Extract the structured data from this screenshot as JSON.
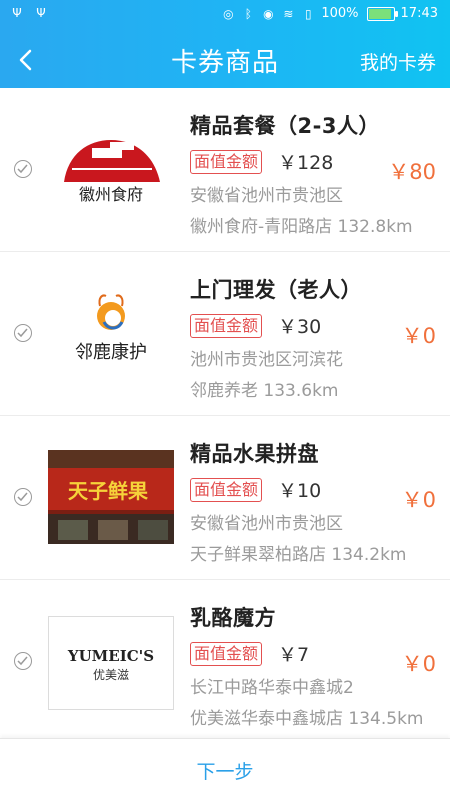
{
  "status_bar": {
    "icons_left": [
      "usb-icon",
      "usb-icon"
    ],
    "icons_right": [
      "vibrate-icon",
      "bluetooth-icon",
      "eye-icon",
      "wifi-icon",
      "sim-icon"
    ],
    "battery": "100%",
    "battery_level": 1.0,
    "time": "17:43"
  },
  "header": {
    "title": "卡券商品",
    "my_cards": "我的卡券"
  },
  "colors": {
    "header_gradient": [
      "#2aa8f0",
      "#10c3f2"
    ],
    "price": "#f0703c",
    "face_tag": "#e35050",
    "next_button": "#2aa0e8"
  },
  "items": [
    {
      "name": "精品套餐（2-3人）",
      "face_label": "面值金额",
      "face_value": "￥128",
      "address": "安徽省池州市贵池区",
      "store": "徽州食府-青阳路店 132.8km",
      "price": "￥80",
      "logo_text": "徽州食府"
    },
    {
      "name": "上门理发（老人）",
      "face_label": "面值金额",
      "face_value": "￥30",
      "address": "池州市贵池区河滨花",
      "store": "邻鹿养老 133.6km",
      "price": "￥0",
      "logo_text": "邻鹿康护"
    },
    {
      "name": "精品水果拼盘",
      "face_label": "面值金额",
      "face_value": "￥10",
      "address": "安徽省池州市贵池区",
      "store": "天子鲜果翠柏路店 134.2km",
      "price": "￥0",
      "logo_text": "天子鲜果"
    },
    {
      "name": "乳酪魔方",
      "face_label": "面值金额",
      "face_value": "￥7",
      "address": "长江中路华泰中鑫城2",
      "store": "优美滋华泰中鑫城店 134.5km",
      "price": "￥0",
      "logo_text": "YUMEIC'S",
      "logo_subtext": "优美滋"
    }
  ],
  "footer": {
    "next_label": "下一步"
  }
}
